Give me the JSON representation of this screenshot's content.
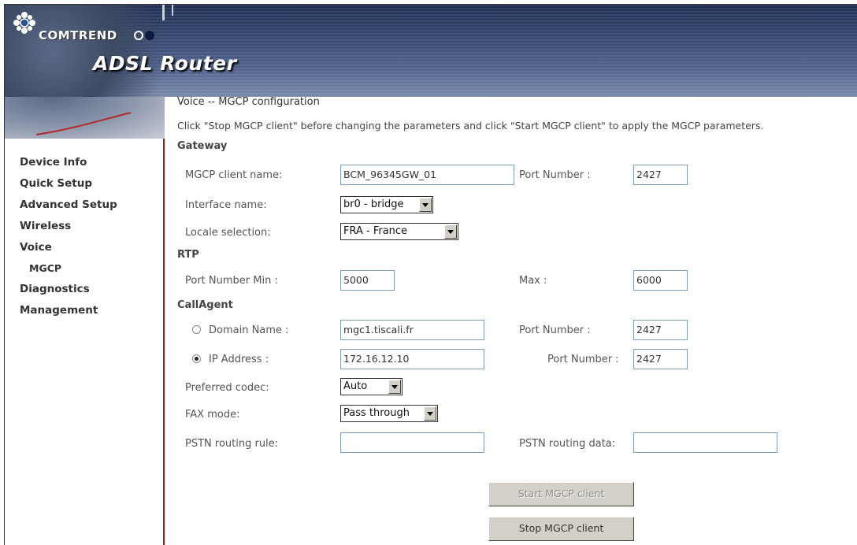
{
  "brand": {
    "logo": "COMTREND",
    "product": "ADSL Router"
  },
  "nav": {
    "items": [
      "Device Info",
      "Quick Setup",
      "Advanced Setup",
      "Wireless",
      "Voice"
    ],
    "sub": "MGCP",
    "items2": [
      "Diagnostics",
      "Management"
    ]
  },
  "page": {
    "title": "Voice -- MGCP configuration",
    "description": "Click \"Stop MGCP client\" before changing the parameters and click \"Start MGCP client\" to apply the MGCP parameters."
  },
  "gateway": {
    "heading": "Gateway",
    "client_name_label": "MGCP client name:",
    "client_name": "BCM_96345GW_01",
    "port_label": "Port Number :",
    "port": "2427",
    "interface_label": "Interface name:",
    "interface": "br0 - bridge",
    "locale_label": "Locale selection:",
    "locale": "FRA - France"
  },
  "rtp": {
    "heading": "RTP",
    "min_label": "Port Number Min :",
    "min": "5000",
    "max_label": "Max :",
    "max": "6000"
  },
  "callagent": {
    "heading": "CallAgent",
    "domain_label": "Domain Name :",
    "domain": "mgc1.tiscali.fr",
    "domain_port_label": "Port Number :",
    "domain_port": "2427",
    "ip_label": "IP Address :",
    "ip": "172.16.12.10",
    "ip_port_label": "Port Number :",
    "ip_port": "2427",
    "selected": "ip"
  },
  "options": {
    "codec_label": "Preferred codec:",
    "codec": "Auto",
    "fax_label": "FAX mode:",
    "fax": "Pass through",
    "pstn_rule_label": "PSTN routing rule:",
    "pstn_rule": "",
    "pstn_data_label": "PSTN routing data:",
    "pstn_data": ""
  },
  "buttons": {
    "start": "Start MGCP client",
    "stop": "Stop MGCP client"
  }
}
